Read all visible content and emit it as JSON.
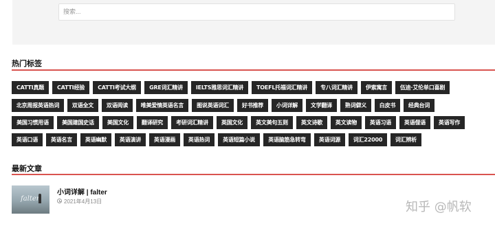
{
  "search": {
    "placeholder": "搜索..."
  },
  "hot_tags": {
    "title": "热门标签",
    "rows": [
      [
        "CATTI真题",
        "CATTI经验",
        "CATTI考试大纲",
        "GRE词汇精讲",
        "IELTS雅思词汇精讲",
        "TOEFL托福词汇精讲",
        "专八词汇精讲",
        "伊索寓言",
        "伍迪·艾伦单口喜剧"
      ],
      [
        "北京周报英语热词",
        "双语全文",
        "双语阅读",
        "唯美爱情英语名言",
        "图说英语词汇",
        "好书推荐",
        "小词详解",
        "文学翻译",
        "熟词僻义",
        "白皮书",
        "经典台词"
      ],
      [
        "美国习惯用语",
        "美国建国史话",
        "美国文化",
        "翻译研究",
        "考研词汇精讲",
        "英国文化",
        "英文美句五则",
        "英文诗歌",
        "英文读物",
        "英语习语",
        "英语俚语",
        "英语写作"
      ],
      [
        "英语口语",
        "英语名言",
        "英语幽默",
        "英语演讲",
        "英语漫画",
        "英语热词",
        "英语短篇小说",
        "英语脑筋急转弯",
        "英语词源",
        "词汇22000",
        "词汇辨析"
      ]
    ]
  },
  "latest": {
    "title": "最新文章",
    "articles": [
      {
        "title": "小词详解 | falter",
        "date": "2021年4月13日",
        "thumb_text": "falter"
      }
    ]
  },
  "watermark": "知乎 @帆软"
}
